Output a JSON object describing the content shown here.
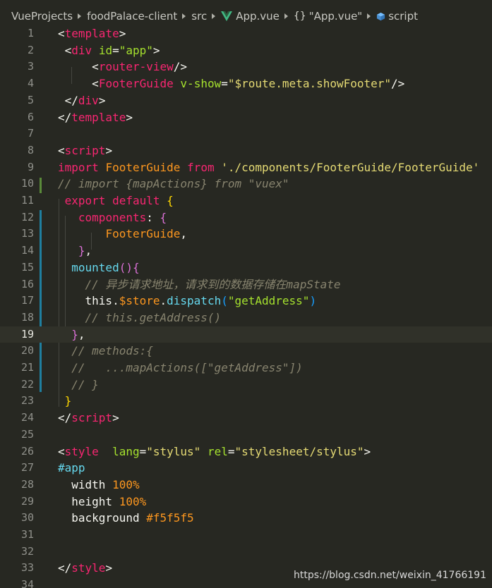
{
  "breadcrumb": {
    "items": [
      "VueProjects",
      "foodPalace-client",
      "src",
      "App.vue",
      "\"App.vue\"",
      "script"
    ]
  },
  "gutter": {
    "line_numbers": [
      "1",
      "2",
      "3",
      "4",
      "5",
      "6",
      "7",
      "8",
      "9",
      "10",
      "11",
      "12",
      "13",
      "14",
      "15",
      "16",
      "17",
      "18",
      "19",
      "20",
      "21",
      "22",
      "23",
      "24",
      "25",
      "26",
      "27",
      "28",
      "29",
      "30",
      "31",
      "32",
      "33",
      "34"
    ],
    "current_line": "19"
  },
  "code": {
    "l1_tag": "template",
    "l2_tag": "div",
    "l2_attr": "id",
    "l2_val": "\"app\"",
    "l3_tag": "router-view",
    "l4_tag": "FooterGuide",
    "l4_attr": "v-show",
    "l4_val": "\"$route.meta.showFooter\"",
    "l5_tag": "div",
    "l6_tag": "template",
    "l8_tag": "script",
    "l9_kw1": "import",
    "l9_name": "FooterGuide",
    "l9_kw2": "from",
    "l9_str": "'./components/FooterGuide/FooterGuide'",
    "l10_comment": "// import {mapActions} from \"vuex\"",
    "l11_kw": "export default",
    "l12_key": "components",
    "l13_name": "FooterGuide",
    "l15_fn": "mounted",
    "l16_comment": "// 异步请求地址，请求到的数据存储在mapState",
    "l17_this": "this",
    "l17_store": "$store",
    "l17_fn": "dispatch",
    "l17_str": "\"getAddress\"",
    "l18_comment": "// this.getAddress()",
    "l20_comment": "// methods:{",
    "l21_comment": "//   ...mapActions([\"getAddress\"])",
    "l22_comment": "// }",
    "l24_tag": "script",
    "l26_tag": "style",
    "l26_attr1": "lang",
    "l26_val1": "\"stylus\"",
    "l26_attr2": "rel",
    "l26_val2": "\"stylesheet/stylus\"",
    "l27_sel": "#app",
    "l28_prop": "width",
    "l28_val": "100%",
    "l29_prop": "height",
    "l29_val": "100%",
    "l30_prop": "background",
    "l30_val": "#f5f5f5",
    "l33_tag": "style"
  },
  "watermark": "https://blog.csdn.net/weixin_41766191",
  "icons": {
    "vue": "vue-logo-icon",
    "braces": "braces-icon",
    "script": "cube-icon"
  },
  "colors": {
    "background": "#272822",
    "tag": "#f92672",
    "attr": "#a6e22e",
    "string": "#e6db74",
    "comment": "#88846f",
    "modified_marker": "#5a8a3a",
    "git_bar": "#1f7fa0"
  }
}
